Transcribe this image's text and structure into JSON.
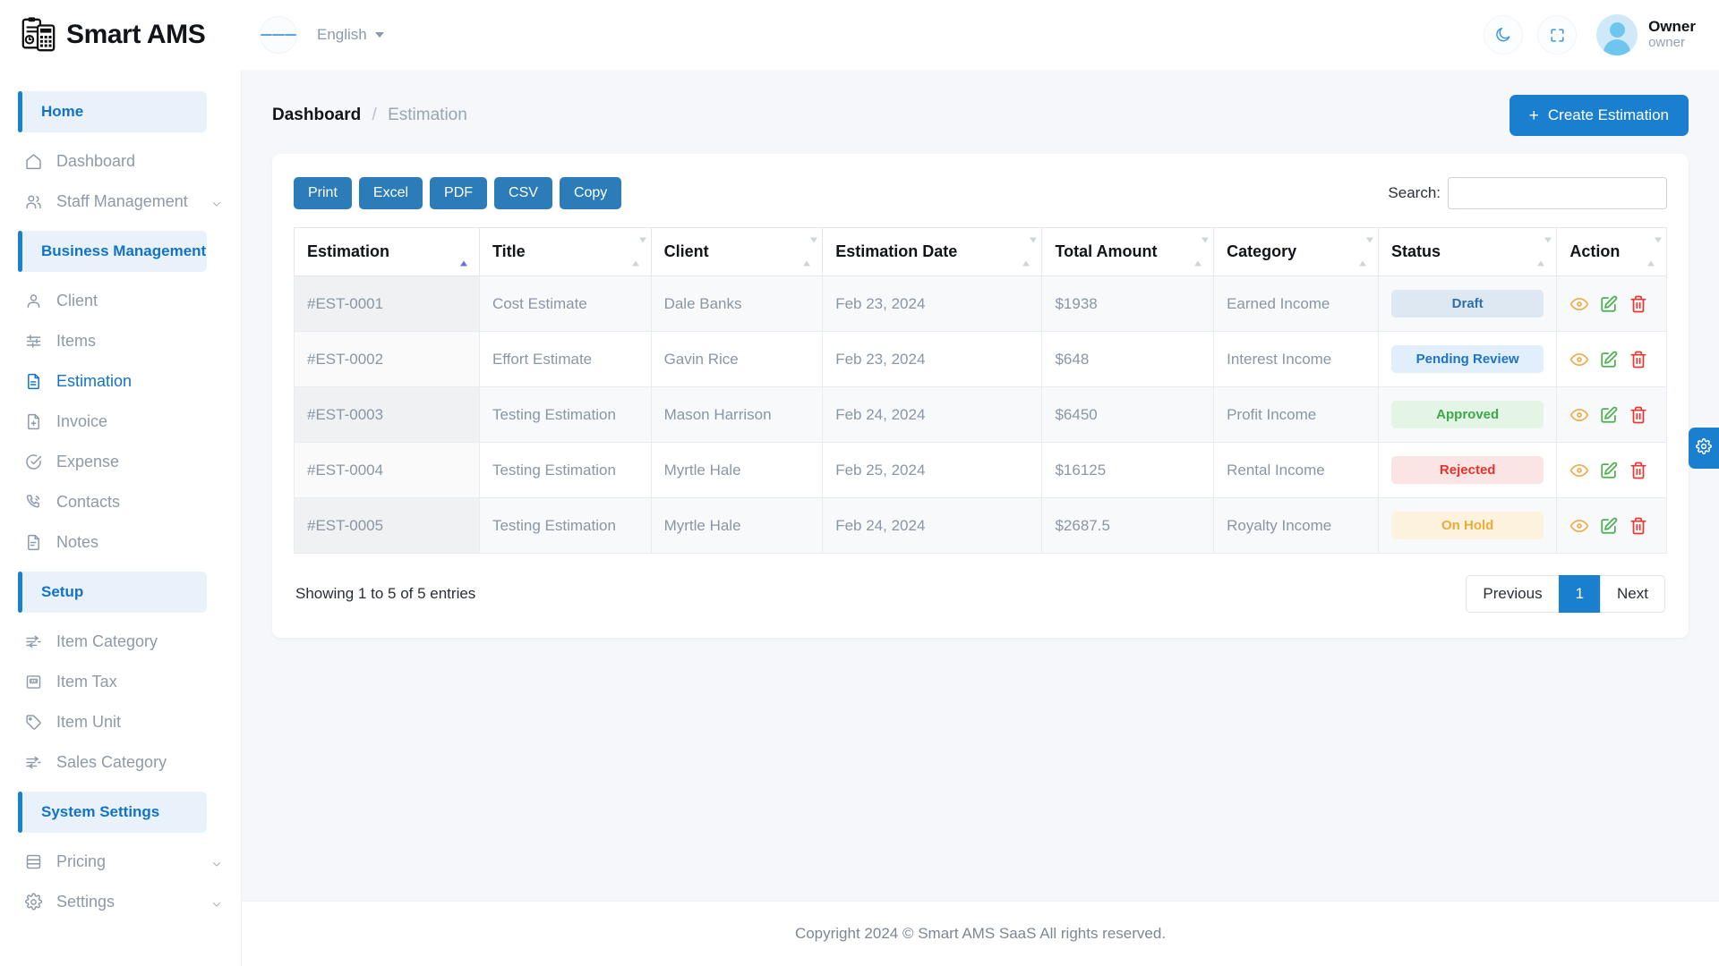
{
  "brand": {
    "name": "Smart AMS",
    "logo_icon": "clipboard-calculator-icon"
  },
  "topbar": {
    "menu_toggle_icon": "hamburger-icon",
    "language": "English",
    "dark_mode_icon": "moon-icon",
    "fullscreen_icon": "fullscreen-icon",
    "user_name": "Owner",
    "user_role": "owner"
  },
  "sidebar": {
    "groups": [
      {
        "title": "Home",
        "items": [
          {
            "label": "Dashboard",
            "icon": "home-icon",
            "active": false,
            "expandable": false
          },
          {
            "label": "Staff Management",
            "icon": "users-icon",
            "active": false,
            "expandable": true
          }
        ]
      },
      {
        "title": "Business Management",
        "items": [
          {
            "label": "Client",
            "icon": "user-icon",
            "active": false,
            "expandable": false
          },
          {
            "label": "Items",
            "icon": "sliders-icon",
            "active": false,
            "expandable": false
          },
          {
            "label": "Estimation",
            "icon": "document-icon",
            "active": true,
            "expandable": false
          },
          {
            "label": "Invoice",
            "icon": "file-plus-icon",
            "active": false,
            "expandable": false
          },
          {
            "label": "Expense",
            "icon": "check-circle-icon",
            "active": false,
            "expandable": false
          },
          {
            "label": "Contacts",
            "icon": "phone-icon",
            "active": false,
            "expandable": false
          },
          {
            "label": "Notes",
            "icon": "note-icon",
            "active": false,
            "expandable": false
          }
        ]
      },
      {
        "title": "Setup",
        "items": [
          {
            "label": "Item Category",
            "icon": "filter-icon",
            "active": false,
            "expandable": false
          },
          {
            "label": "Item Tax",
            "icon": "tax-card-icon",
            "active": false,
            "expandable": false
          },
          {
            "label": "Item Unit",
            "icon": "tag-icon",
            "active": false,
            "expandable": false
          },
          {
            "label": "Sales Category",
            "icon": "filter-icon",
            "active": false,
            "expandable": false
          }
        ]
      },
      {
        "title": "System Settings",
        "items": [
          {
            "label": "Pricing",
            "icon": "database-icon",
            "active": false,
            "expandable": true
          },
          {
            "label": "Settings",
            "icon": "gear-icon",
            "active": false,
            "expandable": true
          }
        ]
      }
    ]
  },
  "page": {
    "breadcrumb_root": "Dashboard",
    "breadcrumb_sep": "/",
    "breadcrumb_current": "Estimation",
    "create_button": "Create Estimation",
    "create_button_icon": "plus-icon"
  },
  "toolbar": {
    "export_buttons": [
      "Print",
      "Excel",
      "PDF",
      "CSV",
      "Copy"
    ],
    "search_label": "Search:",
    "search_value": "",
    "search_placeholder": ""
  },
  "table": {
    "columns": [
      {
        "label": "Estimation",
        "sort": "asc"
      },
      {
        "label": "Title",
        "sort": "none"
      },
      {
        "label": "Client",
        "sort": "none"
      },
      {
        "label": "Estimation Date",
        "sort": "none"
      },
      {
        "label": "Total Amount",
        "sort": "none"
      },
      {
        "label": "Category",
        "sort": "none"
      },
      {
        "label": "Status",
        "sort": "none"
      },
      {
        "label": "Action",
        "sort": "none"
      }
    ],
    "rows": [
      {
        "estimation": "#EST-0001",
        "title": "Cost Estimate",
        "client": "Dale Banks",
        "date": "Feb 23, 2024",
        "amount": "$1938",
        "category": "Earned Income",
        "status": "Draft",
        "status_key": "draft"
      },
      {
        "estimation": "#EST-0002",
        "title": "Effort Estimate",
        "client": "Gavin Rice",
        "date": "Feb 23, 2024",
        "amount": "$648",
        "category": "Interest Income",
        "status": "Pending Review",
        "status_key": "pending"
      },
      {
        "estimation": "#EST-0003",
        "title": "Testing Estimation",
        "client": "Mason Harrison",
        "date": "Feb 24, 2024",
        "amount": "$6450",
        "category": "Profit Income",
        "status": "Approved",
        "status_key": "approved"
      },
      {
        "estimation": "#EST-0004",
        "title": "Testing Estimation",
        "client": "Myrtle Hale",
        "date": "Feb 25, 2024",
        "amount": "$16125",
        "category": "Rental Income",
        "status": "Rejected",
        "status_key": "rejected"
      },
      {
        "estimation": "#EST-0005",
        "title": "Testing Estimation",
        "client": "Myrtle Hale",
        "date": "Feb 24, 2024",
        "amount": "$2687.5",
        "category": "Royalty Income",
        "status": "On Hold",
        "status_key": "onhold"
      }
    ],
    "action_icons": [
      "eye-icon",
      "edit-icon",
      "delete-icon"
    ]
  },
  "pagination": {
    "entries_info": "Showing 1 to 5 of 5 entries",
    "previous": "Previous",
    "pages": [
      "1"
    ],
    "current_page": "1",
    "next": "Next"
  },
  "footer": {
    "text": "Copyright 2024 © Smart AMS SaaS All rights reserved."
  },
  "settings_tab": {
    "icon": "gear-icon"
  },
  "colors": {
    "primary": "#1b7fd0",
    "export_button": "#2b7cb8",
    "status_draft": "#2f6fa8",
    "status_pending": "#1d74c4",
    "status_approved": "#3ca84a",
    "status_rejected": "#e2352c",
    "status_onhold": "#e8ad3c",
    "action_view": "#f0ad4e",
    "action_edit": "#4caf50",
    "action_delete": "#e53935"
  }
}
